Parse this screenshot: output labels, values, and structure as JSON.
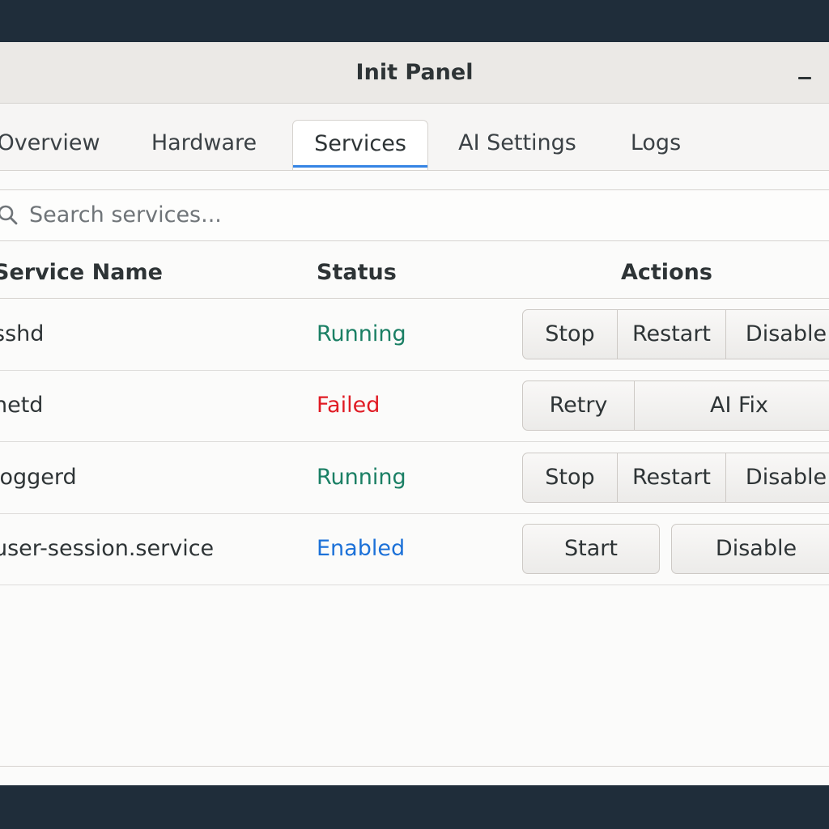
{
  "window": {
    "title": "Init Panel"
  },
  "tabs": [
    {
      "label": "Overview",
      "active": false
    },
    {
      "label": "Hardware",
      "active": false
    },
    {
      "label": "Services",
      "active": true
    },
    {
      "label": "AI Settings",
      "active": false
    },
    {
      "label": "Logs",
      "active": false
    }
  ],
  "search": {
    "placeholder": "Search services...",
    "value": ""
  },
  "table": {
    "columns": [
      "Service Name",
      "Status",
      "Actions"
    ],
    "rows": [
      {
        "name": "sshd",
        "status": "Running",
        "status_color": "#1a7f64",
        "actions": [
          "Stop",
          "Restart",
          "Disable"
        ]
      },
      {
        "name": "netd",
        "status": "Failed",
        "status_color": "#e01b24",
        "actions": [
          "Retry",
          "AI Fix"
        ]
      },
      {
        "name": "loggerd",
        "status": "Running",
        "status_color": "#1a7f64",
        "actions": [
          "Stop",
          "Restart",
          "Disable"
        ]
      },
      {
        "name": "user-session.service",
        "status": "Enabled",
        "status_color": "#1c71d8",
        "actions": [
          "Start",
          "Disable"
        ]
      }
    ]
  },
  "icons": {
    "search": "search-icon",
    "minimize": "minimize-icon"
  },
  "colors": {
    "accent": "#3584e4",
    "running": "#1a7f64",
    "failed": "#e01b24",
    "enabled": "#1c71d8"
  }
}
